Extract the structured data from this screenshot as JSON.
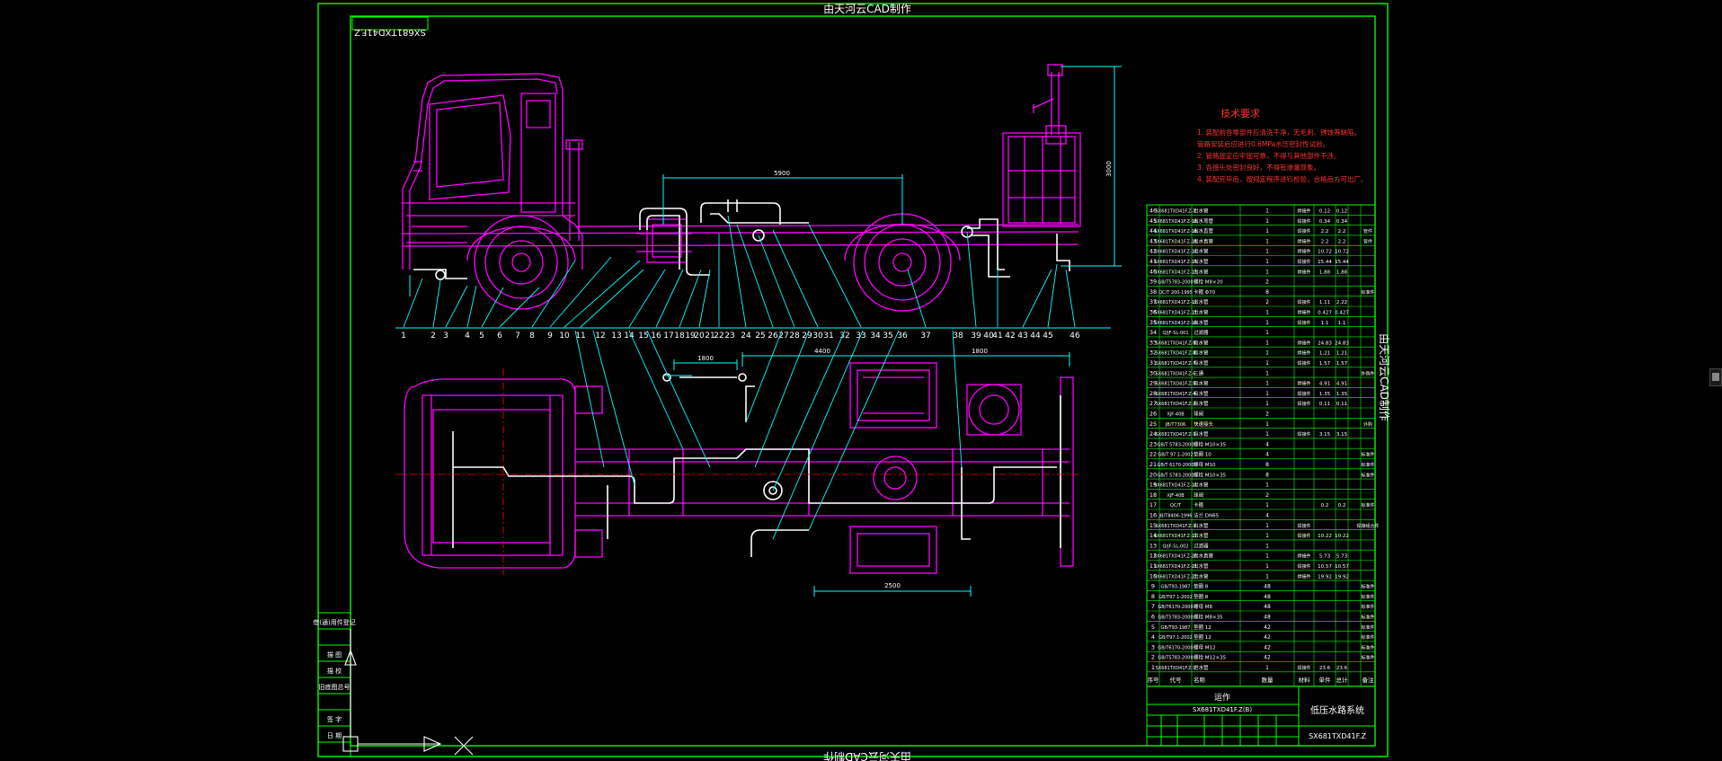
{
  "frame": {
    "top_caption": "由天河云CAD制作",
    "bottom_caption": "由天河云CAD制作",
    "right_caption": "由天河云CAD制作",
    "drawing_code_tag": "SX681TXD41F.Z"
  },
  "notes": {
    "title": "技术要求",
    "lines": [
      "1. 装配前各零部件应清洗干净，无毛刺、锈蚀等缺陷。",
      "   管路安装后应进行0.6MPa水压密封性试验。",
      "2. 管路固定应牢固可靠，不得与其他部件干涉。",
      "3. 各接头处密封良好，不得有渗漏现象。",
      "4. 装配完毕后，按规定程序进行检验，合格后方可出厂。"
    ]
  },
  "callouts": [
    "1",
    "2",
    "3",
    "4",
    "5",
    "6",
    "7",
    "8",
    "9",
    "10",
    "11",
    "12",
    "13",
    "14",
    "15",
    "16",
    "17",
    "18",
    "19",
    "20",
    "21",
    "22",
    "23",
    "24",
    "25",
    "26",
    "27",
    "28",
    "29",
    "30",
    "31",
    "32",
    "33",
    "34",
    "35",
    "36",
    "37",
    "38",
    "39",
    "40",
    "41",
    "42",
    "43",
    "44",
    "45",
    "46"
  ],
  "bom": {
    "rows": [
      {
        "no": "46",
        "code": "SX681TXD41F.Z-3",
        "name": "出水管",
        "qty": "1",
        "mat": "焊接件",
        "w1": "0.12",
        "w2": "0.12",
        "remark": ""
      },
      {
        "no": "45",
        "code": "SX681TXD41F.Z-18",
        "name": "出水弯管",
        "qty": "1",
        "mat": "焊接件",
        "w1": "0.34",
        "w2": "0.34",
        "remark": ""
      },
      {
        "no": "44",
        "code": "SX681TXD41F.Z-16",
        "name": "出水直管",
        "qty": "1",
        "mat": "焊接件",
        "w1": "2.2",
        "w2": "2.2",
        "remark": "管件"
      },
      {
        "no": "43",
        "code": "SX681TXD41F.Z-16",
        "name": "出水直管",
        "qty": "1",
        "mat": "焊接件",
        "w1": "2.2",
        "w2": "2.2",
        "remark": "管件"
      },
      {
        "no": "42",
        "code": "SX681TXD41F.Z-14",
        "name": "出水管",
        "qty": "1",
        "mat": "焊接件",
        "w1": "10.72",
        "w2": "10.72",
        "remark": ""
      },
      {
        "no": "41",
        "code": "SX681TXD41F.Z-15",
        "name": "出水管",
        "qty": "1",
        "mat": "焊接件",
        "w1": "15.44",
        "w2": "15.44",
        "remark": ""
      },
      {
        "no": "40",
        "code": "SX681TXD41F.Z-13",
        "name": "出水管",
        "qty": "1",
        "mat": "焊接件",
        "w1": "1.88",
        "w2": "1.88",
        "remark": ""
      },
      {
        "no": "39",
        "code": "GB/T5783-2000",
        "name": "螺栓 M8×20",
        "qty": "2",
        "mat": "",
        "w1": "",
        "w2": "",
        "remark": ""
      },
      {
        "no": "38",
        "code": "QC/T 200-1995",
        "name": "卡箍 Φ70",
        "qty": "8",
        "mat": "",
        "w1": "",
        "w2": "",
        "remark": "标准件"
      },
      {
        "no": "37",
        "code": "SX681TXD41F.Z-12",
        "name": "出水管",
        "qty": "2",
        "mat": "焊接件",
        "w1": "1.11",
        "w2": "2.22",
        "remark": ""
      },
      {
        "no": "36",
        "code": "SX681TXD41F.Z-11",
        "name": "出水管",
        "qty": "1",
        "mat": "焊接件",
        "w1": "0.427",
        "w2": "0.427",
        "remark": ""
      },
      {
        "no": "35",
        "code": "SX681TXD41F.Z-10",
        "name": "出水管",
        "qty": "1",
        "mat": "焊接件",
        "w1": "1.1",
        "w2": "1.1",
        "remark": ""
      },
      {
        "no": "34",
        "code": "Q/JF-SL-001",
        "name": "过滤器",
        "qty": "1",
        "mat": "",
        "w1": "",
        "w2": "",
        "remark": ""
      },
      {
        "no": "33",
        "code": "SX681TXD41F.Z-9",
        "name": "吸水管",
        "qty": "1",
        "mat": "焊接件",
        "w1": "24.83",
        "w2": "24.83",
        "remark": ""
      },
      {
        "no": "32",
        "code": "SX681TXD41F.Z-8",
        "name": "吸水管",
        "qty": "1",
        "mat": "焊接件",
        "w1": "1.21",
        "w2": "1.21",
        "remark": ""
      },
      {
        "no": "31",
        "code": "SX681TXD41F.Z-7",
        "name": "吸水管",
        "qty": "1",
        "mat": "焊接件",
        "w1": "1.57",
        "w2": "1.57",
        "remark": ""
      },
      {
        "no": "30",
        "code": "SX681TXD41F.Z-6",
        "name": "三通",
        "qty": "1",
        "mat": "",
        "w1": "",
        "w2": "",
        "remark": "外购件"
      },
      {
        "no": "29",
        "code": "SX681TXD41F.Z-5",
        "name": "吸水管",
        "qty": "1",
        "mat": "焊接件",
        "w1": "4.91",
        "w2": "4.91",
        "remark": ""
      },
      {
        "no": "28",
        "code": "SX681TXD41F.Z-4",
        "name": "吸水管",
        "qty": "1",
        "mat": "焊接件",
        "w1": "1.35",
        "w2": "1.35",
        "remark": ""
      },
      {
        "no": "27",
        "code": "SX681TXD41F.Z-2",
        "name": "吸水管",
        "qty": "1",
        "mat": "焊接件",
        "w1": "0.11",
        "w2": "0.11",
        "remark": ""
      },
      {
        "no": "26",
        "code": "XJF-40B",
        "name": "球阀",
        "qty": "2",
        "mat": "",
        "w1": "",
        "w2": "",
        "remark": ""
      },
      {
        "no": "25",
        "code": "JB/T7306",
        "name": "快速接头",
        "qty": "1",
        "mat": "",
        "w1": "",
        "w2": "",
        "remark": "外购"
      },
      {
        "no": "24",
        "code": "SX681TXD41F.Z-1",
        "name": "吸水管",
        "qty": "1",
        "mat": "焊接件",
        "w1": "3.15",
        "w2": "3.15",
        "remark": ""
      },
      {
        "no": "23",
        "code": "GB/T 5783-2000",
        "name": "螺栓 M10×35",
        "qty": "4",
        "mat": "",
        "w1": "",
        "w2": "",
        "remark": ""
      },
      {
        "no": "22",
        "code": "GB/T 97.1-2002",
        "name": "垫圈 10",
        "qty": "4",
        "mat": "",
        "w1": "",
        "w2": "",
        "remark": "标准件"
      },
      {
        "no": "21",
        "code": "GB/T 6170-2000",
        "name": "螺母 M10",
        "qty": "8",
        "mat": "",
        "w1": "",
        "w2": "",
        "remark": "标准件"
      },
      {
        "no": "20",
        "code": "GB/T 5783-2000",
        "name": "螺栓 M10×35",
        "qty": "8",
        "mat": "",
        "w1": "",
        "w2": "",
        "remark": "标准件"
      },
      {
        "no": "19",
        "code": "SX681TXD41F.Z-14",
        "name": "出水管",
        "qty": "1",
        "mat": "",
        "w1": "",
        "w2": "",
        "remark": ""
      },
      {
        "no": "18",
        "code": "XJF-40B",
        "name": "球阀",
        "qty": "2",
        "mat": "",
        "w1": "",
        "w2": "",
        "remark": ""
      },
      {
        "no": "17",
        "code": "QC/T",
        "name": "卡箍",
        "qty": "1",
        "mat": "",
        "w1": "0.2",
        "w2": "0.2",
        "remark": "标准件"
      },
      {
        "no": "16",
        "code": "JB/T8406-1996",
        "name": "法兰 DN65",
        "qty": "4",
        "mat": "",
        "w1": "",
        "w2": "",
        "remark": ""
      },
      {
        "no": "15",
        "code": "SX681TXD41F.Z-3",
        "name": "出水管",
        "qty": "1",
        "mat": "焊接件",
        "w1": "",
        "w2": "",
        "remark": "焊接组合件"
      },
      {
        "no": "14",
        "code": "SX681TXD41F.Z-17",
        "name": "出水管",
        "qty": "1",
        "mat": "焊接件",
        "w1": "10.22",
        "w2": "10.22",
        "remark": ""
      },
      {
        "no": "13",
        "code": "Q/JF-SL-002",
        "name": "过滤器",
        "qty": "1",
        "mat": "",
        "w1": "",
        "w2": "",
        "remark": ""
      },
      {
        "no": "12",
        "code": "SX681TXD41F.Z-20",
        "name": "出水直管",
        "qty": "1",
        "mat": "焊接件",
        "w1": "5.73",
        "w2": "5.73",
        "remark": ""
      },
      {
        "no": "11",
        "code": "SX681TXD41F.Z-21",
        "name": "出水管",
        "qty": "1",
        "mat": "焊接件",
        "w1": "10.57",
        "w2": "10.57",
        "remark": ""
      },
      {
        "no": "10",
        "code": "SX681TXD41F.Z-22",
        "name": "出水管",
        "qty": "1",
        "mat": "焊接件",
        "w1": "19.92",
        "w2": "19.92",
        "remark": ""
      },
      {
        "no": "9",
        "code": "GB/T93-1987",
        "name": "垫圈 8",
        "qty": "48",
        "mat": "",
        "w1": "",
        "w2": "",
        "remark": "标准件"
      },
      {
        "no": "8",
        "code": "GB/T97.1-2002",
        "name": "垫圈 8",
        "qty": "48",
        "mat": "",
        "w1": "",
        "w2": "",
        "remark": "标准件"
      },
      {
        "no": "7",
        "code": "GB/T6170-2000",
        "name": "螺母 M8",
        "qty": "48",
        "mat": "",
        "w1": "",
        "w2": "",
        "remark": "标准件"
      },
      {
        "no": "6",
        "code": "GB/T5783-2000",
        "name": "螺栓 M8×35",
        "qty": "48",
        "mat": "",
        "w1": "",
        "w2": "",
        "remark": "标准件"
      },
      {
        "no": "5",
        "code": "GB/T93-1987",
        "name": "垫圈 12",
        "qty": "42",
        "mat": "",
        "w1": "",
        "w2": "",
        "remark": "标准件"
      },
      {
        "no": "4",
        "code": "GB/T97.1-2002",
        "name": "垫圈 12",
        "qty": "42",
        "mat": "",
        "w1": "",
        "w2": "",
        "remark": "标准件"
      },
      {
        "no": "3",
        "code": "GB/T6170-2000",
        "name": "螺母 M12",
        "qty": "42",
        "mat": "",
        "w1": "",
        "w2": "",
        "remark": "标准件"
      },
      {
        "no": "2",
        "code": "GB/T5783-2000",
        "name": "螺栓 M12×35",
        "qty": "42",
        "mat": "",
        "w1": "",
        "w2": "",
        "remark": "标准件"
      },
      {
        "no": "1",
        "code": "SX681TXD41F.Z-1",
        "name": "进水管",
        "qty": "1",
        "mat": "焊接件",
        "w1": "23.6",
        "w2": "23.6",
        "remark": ""
      }
    ],
    "header": [
      "序号",
      "代号",
      "名称",
      "数量",
      "材料",
      "单件",
      "总计",
      "备注"
    ]
  },
  "title_block": {
    "company": "运作",
    "drawing_no_top": "SX681TXD41F.Z(B)",
    "title": "低压水路系统",
    "drawing_no": "SX681TXD41F.Z"
  },
  "left_block": {
    "rows": [
      "借(通)用件登记",
      "",
      "描 图",
      "描 校",
      "旧底图总号",
      "",
      "签 字",
      "日 期"
    ]
  },
  "colors": {
    "frame": "#00ff00",
    "vehicle": "#ff00ff",
    "dimension": "#00ffff",
    "notes": "#ff0000",
    "title": "#ff3333",
    "text": "#ffffff",
    "background": "#000000"
  }
}
